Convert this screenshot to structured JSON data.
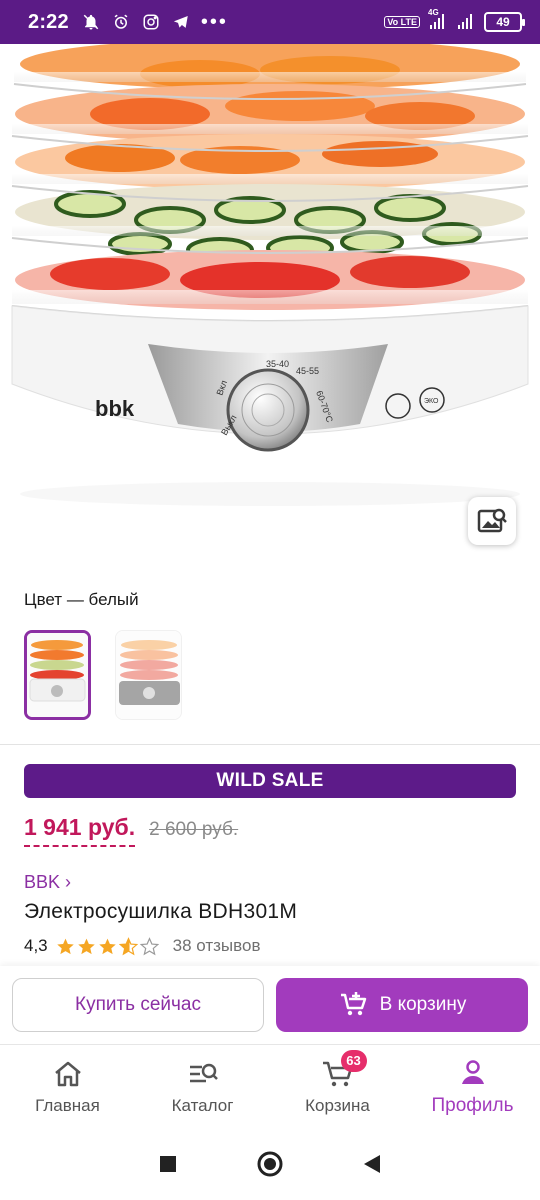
{
  "status_bar": {
    "time": "2:22",
    "network_label": "4G",
    "lte_label": "Vo LTE",
    "battery": "49",
    "more": "•••"
  },
  "product": {
    "color_label": "Цвет — белый",
    "sale_banner": "WILD SALE",
    "price_current": "1 941 руб.",
    "price_old": "2 600 руб.",
    "brand": "BBK ›",
    "title": "Электросушилка BDH301M",
    "rating": "4,3",
    "rating_stars": 4.3,
    "reviews": "38 отзывов"
  },
  "device_label": {
    "brand_logo": "bbk",
    "dial_marks": [
      "35-40",
      "45-55",
      "60-70°C",
      "Вкл",
      "Выкл"
    ]
  },
  "actions": {
    "buy_now": "Купить сейчас",
    "add_to_cart": "В корзину"
  },
  "nav": {
    "home": "Главная",
    "catalog": "Каталог",
    "cart": "Корзина",
    "cart_count": "63",
    "profile": "Профиль"
  },
  "colors": {
    "status_bar": "#5b1b86",
    "accent": "#a23bbd",
    "sale": "#5d1b89",
    "price": "#c1185b",
    "badge": "#e62e6b",
    "star": "#f5a623"
  }
}
